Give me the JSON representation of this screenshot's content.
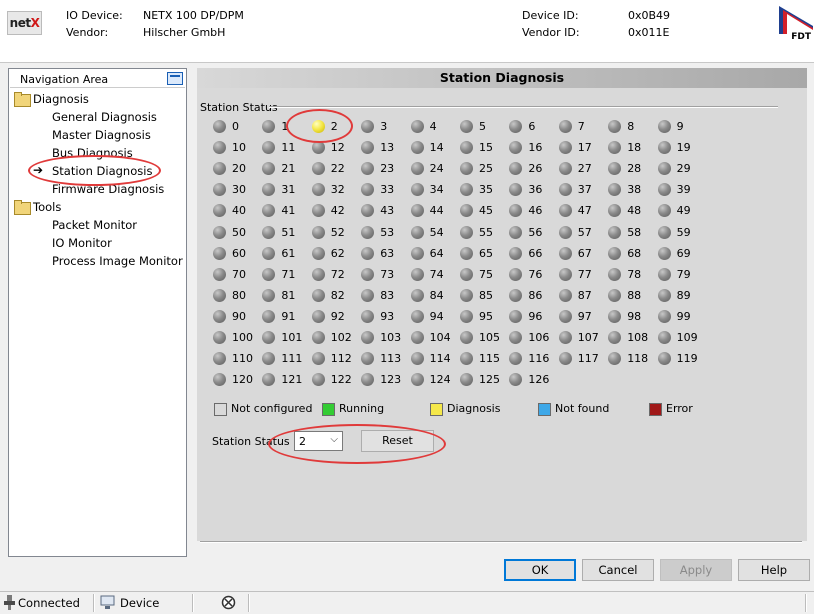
{
  "header": {
    "logo_text": "netX",
    "io_device_label": "IO Device:",
    "io_device_value": "NETX 100 DP/DPM",
    "vendor_label": "Vendor:",
    "vendor_value": "Hilscher GmbH",
    "device_id_label": "Device ID:",
    "device_id_value": "0x0B49",
    "vendor_id_label": "Vendor ID:",
    "vendor_id_value": "0x011E",
    "fdt_logo_text": "FDT"
  },
  "nav": {
    "title": "Navigation Area",
    "groups": [
      {
        "label": "Diagnosis",
        "items": [
          "General Diagnosis",
          "Master Diagnosis",
          "Bus Diagnosis",
          "Station Diagnosis",
          "Firmware Diagnosis"
        ]
      },
      {
        "label": "Tools",
        "items": [
          "Packet Monitor",
          "IO Monitor",
          "Process Image Monitor"
        ]
      }
    ],
    "selected": "Station Diagnosis"
  },
  "main": {
    "title": "Station Diagnosis",
    "group_label": "Station Status",
    "station_count": 127,
    "active_station": 2,
    "status_colors": {
      "inactive": "#8a8a8a",
      "diagnosis": "#f5e84a"
    },
    "legend": [
      {
        "label": "Not configured",
        "color": "#d9d9d9"
      },
      {
        "label": "Running",
        "color": "#33cc33"
      },
      {
        "label": "Diagnosis",
        "color": "#f5e84a"
      },
      {
        "label": "Not found",
        "color": "#3ea8e8"
      },
      {
        "label": "Error",
        "color": "#a01818"
      }
    ],
    "controls": {
      "station_status_label": "Station Status",
      "selected_value": "2",
      "reset_label": "Reset"
    }
  },
  "buttons": {
    "ok": "OK",
    "cancel": "Cancel",
    "apply": "Apply",
    "help": "Help"
  },
  "statusbar": {
    "connected": "Connected",
    "device": "Device"
  },
  "annotation_color": "#e03a3a"
}
